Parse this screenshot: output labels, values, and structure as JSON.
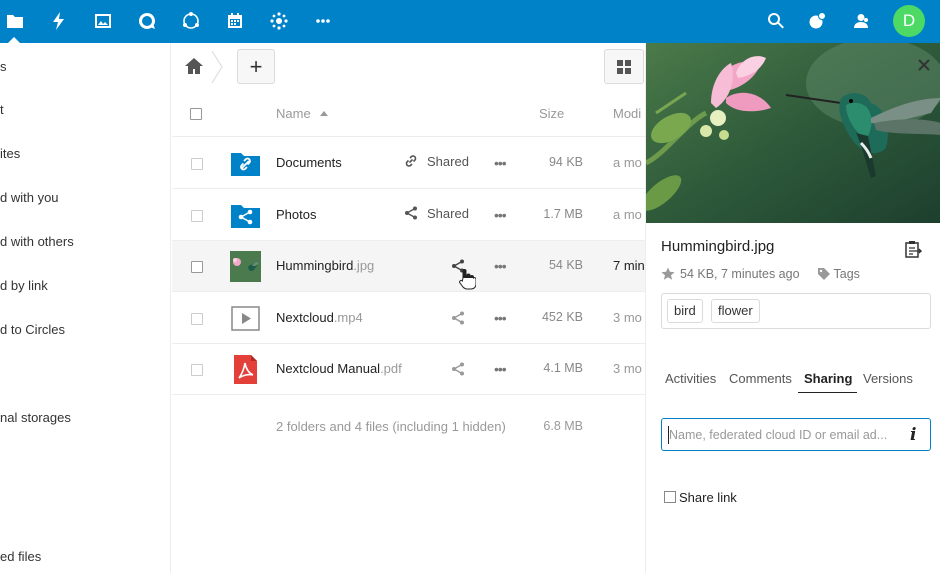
{
  "header": {
    "apps": [
      "files-icon",
      "activity-icon",
      "gallery-icon",
      "talk-icon",
      "circles-icon",
      "calendar-icon",
      "deck-icon",
      "more-apps-icon"
    ],
    "right": [
      "search-icon",
      "notifications-icon",
      "contacts-icon"
    ],
    "avatar_letter": "D",
    "colors": {
      "primary": "#0082c9",
      "avatar": "#4cd964"
    }
  },
  "sidebar": {
    "items": [
      {
        "label": "s"
      },
      {
        "label": "t"
      },
      {
        "label": "ites"
      },
      {
        "label": "d with you"
      },
      {
        "label": "d with others"
      },
      {
        "label": "d by link"
      },
      {
        "label": "d to Circles"
      },
      {
        "label": "nal storages"
      },
      {
        "label": "ed files"
      }
    ]
  },
  "toolbar": {
    "add_label": "+"
  },
  "table": {
    "headers": {
      "name": "Name",
      "size": "Size",
      "modified": "Modi"
    },
    "rows": [
      {
        "name": "Documents",
        "ext": "",
        "share": "Shared",
        "size": "94 KB",
        "modified": "a mo"
      },
      {
        "name": "Photos",
        "ext": "",
        "share": "Shared",
        "size": "1.7 MB",
        "modified": "a mo"
      },
      {
        "name": "Hummingbird",
        "ext": ".jpg",
        "share": "",
        "size": "54 KB",
        "modified": "7 min"
      },
      {
        "name": "Nextcloud",
        "ext": ".mp4",
        "share": "",
        "size": "452 KB",
        "modified": "3 mo"
      },
      {
        "name": "Nextcloud Manual",
        "ext": ".pdf",
        "share": "",
        "size": "4.1 MB",
        "modified": "3 mo"
      }
    ],
    "summary": "2 folders and 4 files (including 1 hidden)",
    "summary_size": "6.8 MB"
  },
  "detail": {
    "filename": "Hummingbird.jpg",
    "meta": "54 KB, 7 minutes ago",
    "tags_label": "Tags",
    "tags": [
      "bird",
      "flower"
    ],
    "tabs": [
      "Activities",
      "Comments",
      "Sharing",
      "Versions"
    ],
    "active_tab": "Sharing",
    "share_placeholder": "Name, federated cloud ID or email ad...",
    "share_link_label": "Share link"
  }
}
